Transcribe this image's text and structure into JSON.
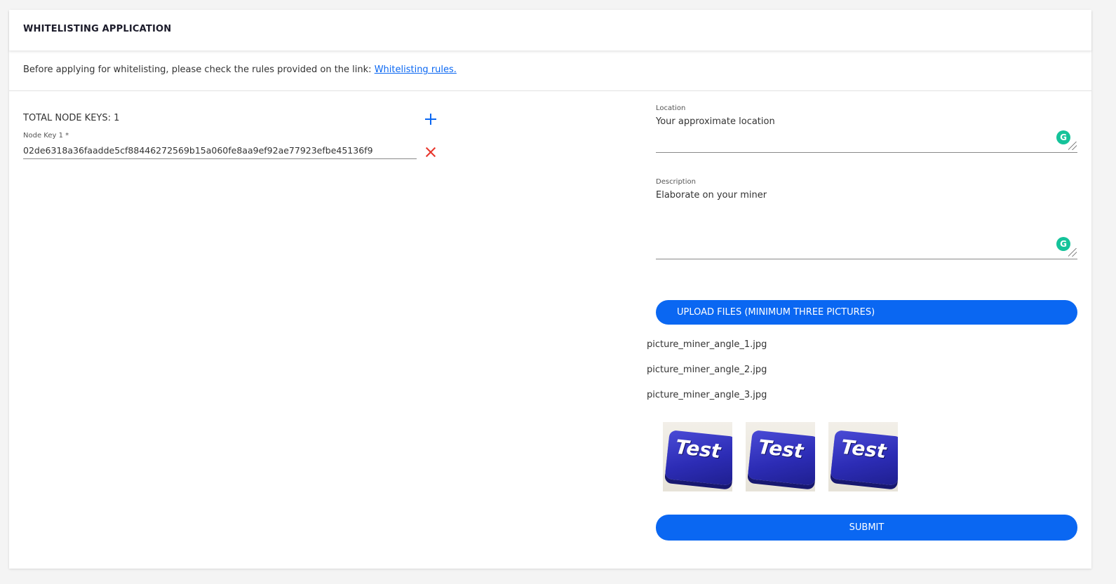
{
  "header": {
    "title": "WHITELISTING APPLICATION"
  },
  "notice": {
    "text": "Before applying for whitelisting, please check the rules provided on the link: ",
    "link_label": "Whitelisting rules."
  },
  "node_keys": {
    "total_label": "TOTAL NODE KEYS: 1",
    "items": [
      {
        "label": "Node Key 1 *",
        "value": "02de6318a36faadde5cf88446272569b15a060fe8aa9ef92ae77923efbe45136f9"
      }
    ]
  },
  "location": {
    "label": "Location",
    "placeholder": "Your approximate location"
  },
  "description": {
    "label": "Description",
    "placeholder": "Elaborate on your miner"
  },
  "grammarly_icon": "G",
  "upload": {
    "button_label": "UPLOAD FILES (MINIMUM THREE PICTURES)",
    "files": [
      "picture_miner_angle_1.jpg",
      "picture_miner_angle_2.jpg",
      "picture_miner_angle_3.jpg"
    ]
  },
  "thumbnails": [
    {
      "text": "Test",
      "icon": "test-key-image"
    },
    {
      "text": "Test",
      "icon": "test-key-image"
    },
    {
      "text": "Test",
      "icon": "test-key-image"
    }
  ],
  "submit_label": "SUBMIT",
  "colors": {
    "accent": "#0a67f2",
    "danger": "#e8342a",
    "grammarly": "#15c39a"
  }
}
